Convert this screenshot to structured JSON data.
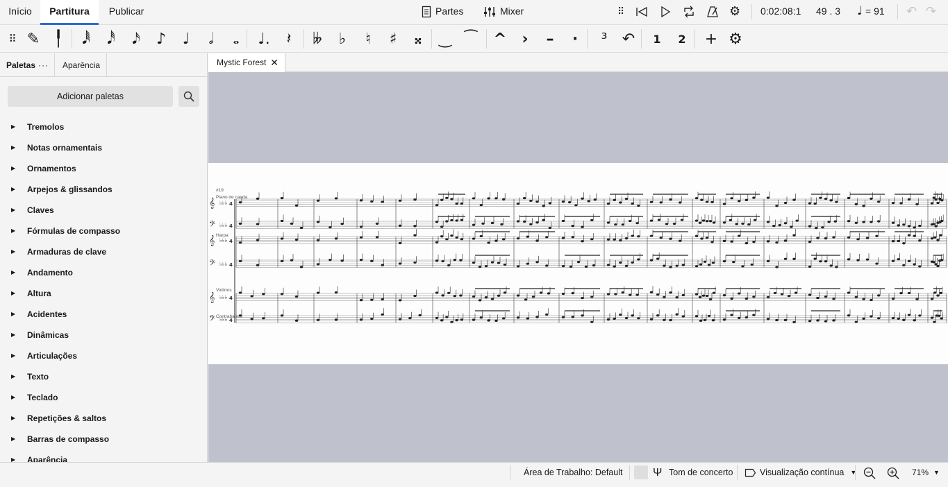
{
  "app": {
    "tabs": [
      "Início",
      "Partitura",
      "Publicar"
    ],
    "active_tab": "Partitura",
    "parts_label": "Partes",
    "mixer_label": "Mixer",
    "time": "0:02:08:1",
    "measure_beat": "49 . 3",
    "tempo": "= 91"
  },
  "note_toolbar": {
    "icons": [
      "drag-handle-icon",
      "pencil-icon",
      "input-cursor-icon",
      "sixty-fourth-note-icon",
      "thirty-second-note-icon",
      "sixteenth-note-icon",
      "eighth-note-icon",
      "quarter-note-icon",
      "half-note-icon",
      "whole-note-icon",
      "augmentation-dot-icon",
      "rest-icon",
      "double-flat-icon",
      "flat-icon",
      "natural-icon",
      "sharp-icon",
      "double-sharp-icon",
      "tie-icon",
      "slur-icon",
      "marcato-icon",
      "accent-icon",
      "tenuto-icon",
      "staccato-icon",
      "tuplet-icon",
      "flip-direction-icon",
      "voice-1-icon",
      "voice-2-icon",
      "add-icon",
      "settings-icon"
    ],
    "glyphs": [
      "⠿",
      "✎",
      "╿",
      "𝅘𝅥𝅱",
      "𝅘𝅥𝅰",
      "𝅘𝅥𝅯",
      "♪",
      "♩",
      "𝅗𝅥",
      "𝅝",
      "♩.",
      "𝄽",
      "𝄫",
      "♭",
      "♮",
      "♯",
      "𝄪",
      "‿",
      "⁀",
      "^",
      "›",
      "–",
      "·",
      "³",
      "↶",
      "1",
      "2",
      "+",
      "⚙"
    ]
  },
  "palettes_panel": {
    "tab_palettes": "Paletas",
    "tab_more": "···",
    "tab_appearance": "Aparência",
    "add_button": "Adicionar paletas",
    "items": [
      "Tremolos",
      "Notas ornamentais",
      "Ornamentos",
      "Arpejos & glissandos",
      "Claves",
      "Fórmulas de compasso",
      "Armaduras de clave",
      "Andamento",
      "Altura",
      "Acidentes",
      "Dinâmicas",
      "Articulações",
      "Texto",
      "Teclado",
      "Repetições & saltos",
      "Barras de compasso",
      "Aparência"
    ]
  },
  "document": {
    "tab_title": "Mystic Forest",
    "measure_number": "#19",
    "instruments": [
      "Piano de cauda",
      "Harpa",
      "Violinos",
      "Contrabaixos"
    ]
  },
  "status": {
    "workspace": "Área de Trabalho: Default",
    "concert_pitch": "Tom de concerto",
    "view_mode": "Visualização contínua",
    "zoom": "71%"
  }
}
